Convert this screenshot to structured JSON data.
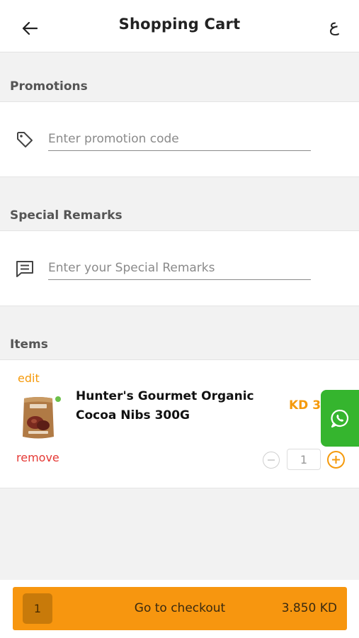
{
  "header": {
    "title": "Shopping Cart",
    "lang_toggle": "ع",
    "back_icon": "arrow-left-icon"
  },
  "promotions": {
    "label": "Promotions",
    "icon": "tag-icon",
    "placeholder": "Enter promotion code",
    "value": ""
  },
  "remarks": {
    "label": "Special Remarks",
    "icon": "comment-icon",
    "placeholder": "Enter your Special Remarks",
    "value": ""
  },
  "items": {
    "label": "Items",
    "list": [
      {
        "edit_label": "edit",
        "name": "Hunter's Gourmet Organic Cocoa Nibs 300G",
        "price": "KD 3.",
        "remove_label": "remove",
        "quantity": "1"
      }
    ]
  },
  "floating": {
    "whatsapp_icon": "whatsapp-icon"
  },
  "checkout": {
    "count": "1",
    "label": "Go to checkout",
    "total": "3.850 KD"
  },
  "colors": {
    "accent": "#f7960f",
    "remove": "#e53935",
    "whatsapp": "#35b52e"
  }
}
